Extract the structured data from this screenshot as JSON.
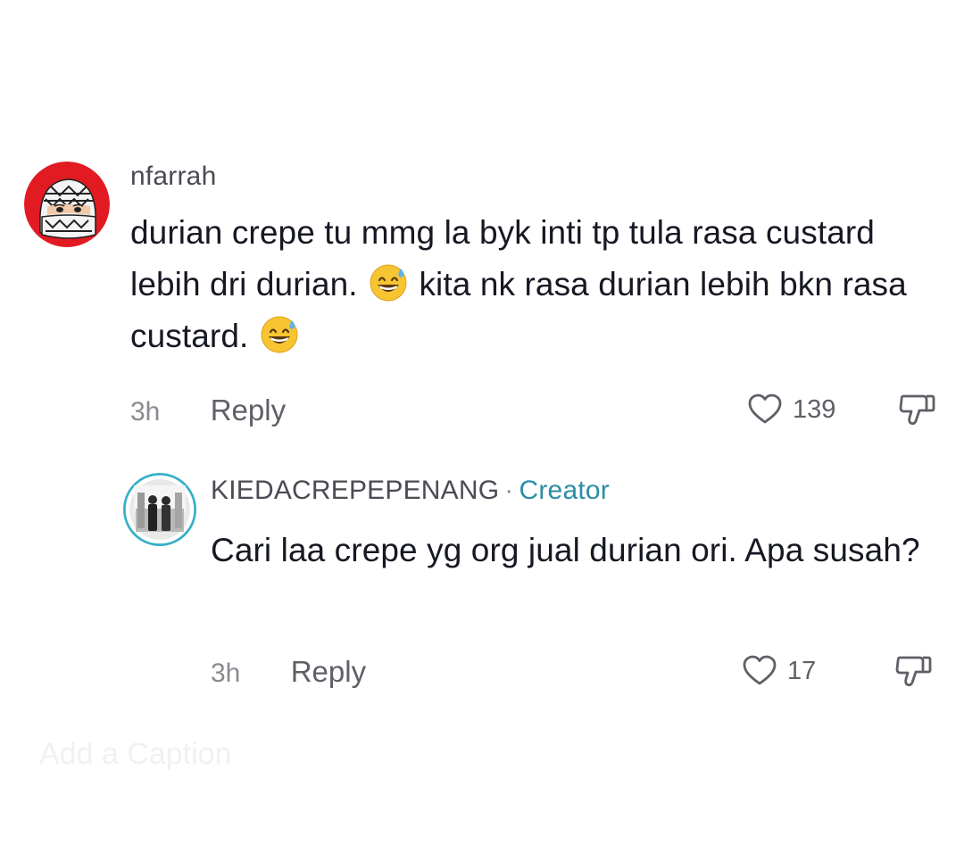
{
  "comments": [
    {
      "username": "nfarrah",
      "text_parts": [
        "durian crepe tu mmg la byk inti tp tula rasa custard lebih dri durian. ",
        " kita nk rasa durian lebih bkn rasa custard. "
      ],
      "emoji": "grinning-face-with-sweat-emoji",
      "time": "3h",
      "reply_label": "Reply",
      "likes": "139",
      "avatar_color": "#e21b23"
    },
    {
      "username": "KIEDACREPEPENANG",
      "separator": "·",
      "creator_label": "Creator",
      "text": "Cari laa crepe yg org jual durian ori. Apa susah?",
      "time": "3h",
      "reply_label": "Reply",
      "likes": "17",
      "avatar_ring_color": "#35b0c6"
    }
  ],
  "caption_placeholder": "Add a Caption",
  "colors": {
    "text_primary": "#161823",
    "text_secondary": "#8a8b91",
    "creator_accent": "#2b8ea5"
  }
}
